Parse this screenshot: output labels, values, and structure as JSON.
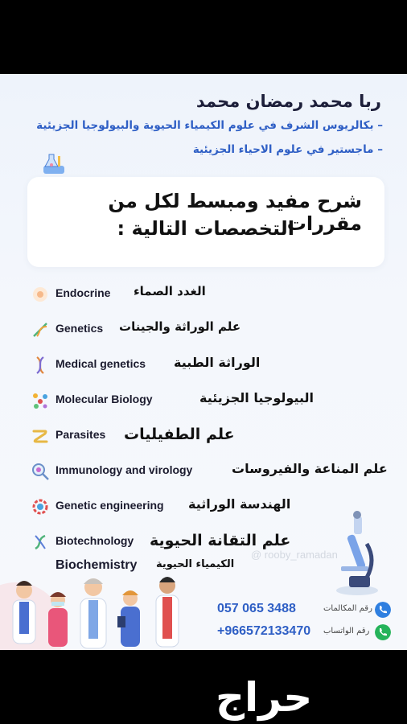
{
  "profile": {
    "name": "ربا محمد رمضان محمد",
    "degree_1": "– بكالريوس الشرف في علوم الكيمياء الحيوية والبيولوجيا الجزيئية",
    "degree_2": "– ماجستير في علوم الاحياء الجزيئية"
  },
  "headline": {
    "line1": "شرح مفيد ومبسط لكل من مقررات",
    "line2": "التخصصات التالية :"
  },
  "courses": [
    {
      "en": "Endocrine",
      "ar": "الغدد الصماء",
      "icon": "gland-icon"
    },
    {
      "en": "Genetics",
      "ar": "علم الوراثة والجينات",
      "icon": "dna-icon"
    },
    {
      "en": "Medical genetics",
      "ar": "الوراثة الطبية",
      "icon": "dna-helix-icon"
    },
    {
      "en": "Molecular Biology",
      "ar": "البيولوجيا الجزيئية",
      "icon": "molecule-icon"
    },
    {
      "en": "Parasites",
      "ar": "علم الطفيليات",
      "icon": "worm-icon"
    },
    {
      "en": "Immunology and virology",
      "ar": "علم المناعة والفيروسات",
      "icon": "virus-magnifier-icon"
    },
    {
      "en": "Genetic engineering",
      "ar": "الهندسة الوراثية",
      "icon": "gear-dna-icon"
    },
    {
      "en": "Biotechnology",
      "ar": "علم التقانة الحيوية",
      "icon": "biotech-icon"
    },
    {
      "en": "Biochemistry",
      "ar": "الكيمياء الحيوية",
      "icon": ""
    }
  ],
  "contact": {
    "phone_label": "رقم المكالمات",
    "phone": "057 065 3488",
    "whatsapp_label": "رقم الواتساب",
    "whatsapp": "+966572133470"
  },
  "watermark": "@ rooby_ramadan",
  "brand": "حراج",
  "colors": {
    "accent_blue": "#2f5fc5",
    "phone_green": "#25b35a"
  }
}
